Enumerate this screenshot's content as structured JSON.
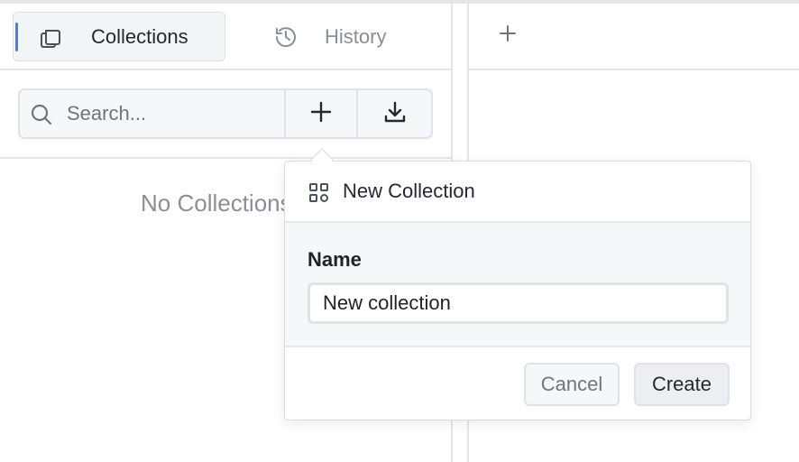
{
  "sidebar": {
    "tabs": [
      {
        "label": "Collections",
        "icon": "collections-icon",
        "active": true
      },
      {
        "label": "History",
        "icon": "history-icon",
        "active": false
      }
    ],
    "search": {
      "placeholder": "Search...",
      "value": ""
    },
    "actions": {
      "add_icon": "plus-icon",
      "import_icon": "download-icon"
    },
    "empty_text": "No Collections"
  },
  "panel": {
    "add_tab_icon": "plus-icon"
  },
  "popover": {
    "title": "New Collection",
    "icon": "grid-icon",
    "field_label": "Name",
    "name_value": "New collection",
    "cancel_label": "Cancel",
    "create_label": "Create"
  },
  "colors": {
    "accent": "#3b82f6",
    "border": "#e4e6e9",
    "muted_text": "#8a8f96"
  }
}
